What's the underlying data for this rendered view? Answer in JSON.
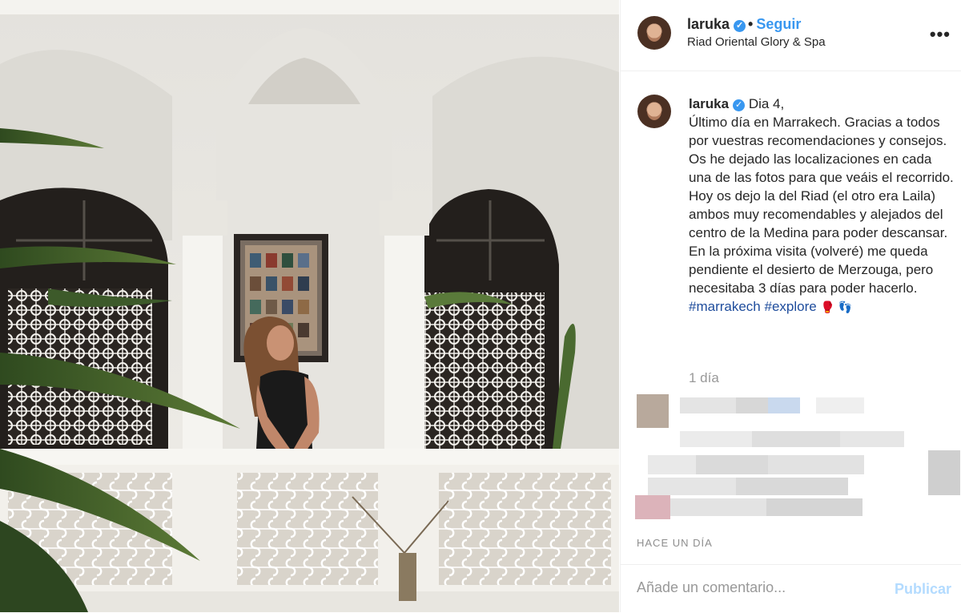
{
  "post": {
    "username": "laruka",
    "follow_label": "Seguir",
    "separator": "•",
    "location": "Riad Oriental Glory & Spa",
    "more_label": "•••"
  },
  "caption": {
    "username": "laruka",
    "text": "Dia 4,\nÚltimo día en Marrakech. Gracias a todos por vuestras recomendaciones y consejos. Os he dejado las localizaciones en cada una de las fotos para que veáis el recorrido. Hoy os dejo la del Riad (el otro era Laila) ambos muy recomendables y alejados del centro de la Medina para poder descansar. En la próxima visita (volveré) me queda pendiente el desierto de Merzouga, pero necesitaba 3 días para poder hacerlo.",
    "hashtags": [
      "#marrakech",
      "#explore"
    ],
    "emojis": [
      "🥊",
      "👣"
    ],
    "time_ago": "1 día"
  },
  "footer": {
    "timestamp": "HACE UN DÍA",
    "comment_placeholder": "Añade un comentario...",
    "publish_label": "Publicar"
  },
  "icons": {
    "verified": "verified-badge-icon",
    "more": "more-options-icon"
  },
  "colors": {
    "link_blue": "#3897f0",
    "hashtag_blue": "#1e4c9c",
    "publish_disabled": "#b3dbff",
    "muted": "#999999"
  }
}
